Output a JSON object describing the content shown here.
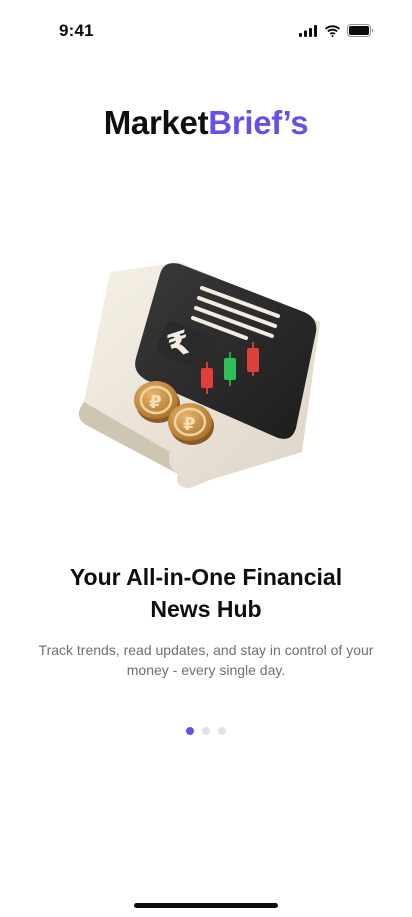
{
  "status_bar": {
    "time": "9:41",
    "icons": [
      "cellular-signal-icon",
      "wifi-icon",
      "battery-icon"
    ]
  },
  "brand": {
    "part_a": "Market",
    "part_b": "Brief’s",
    "accent_color": "#6b4eea"
  },
  "hero": {
    "icon": "finance-document-illustration"
  },
  "onboarding": {
    "headline_line1": "Your All-in-One Financial",
    "headline_line2": "News Hub",
    "subtext_line1": "Track trends, read updates, and stay in control of your",
    "subtext_line2": "money - every single day."
  },
  "pagination": {
    "current": 1,
    "total": 3
  }
}
